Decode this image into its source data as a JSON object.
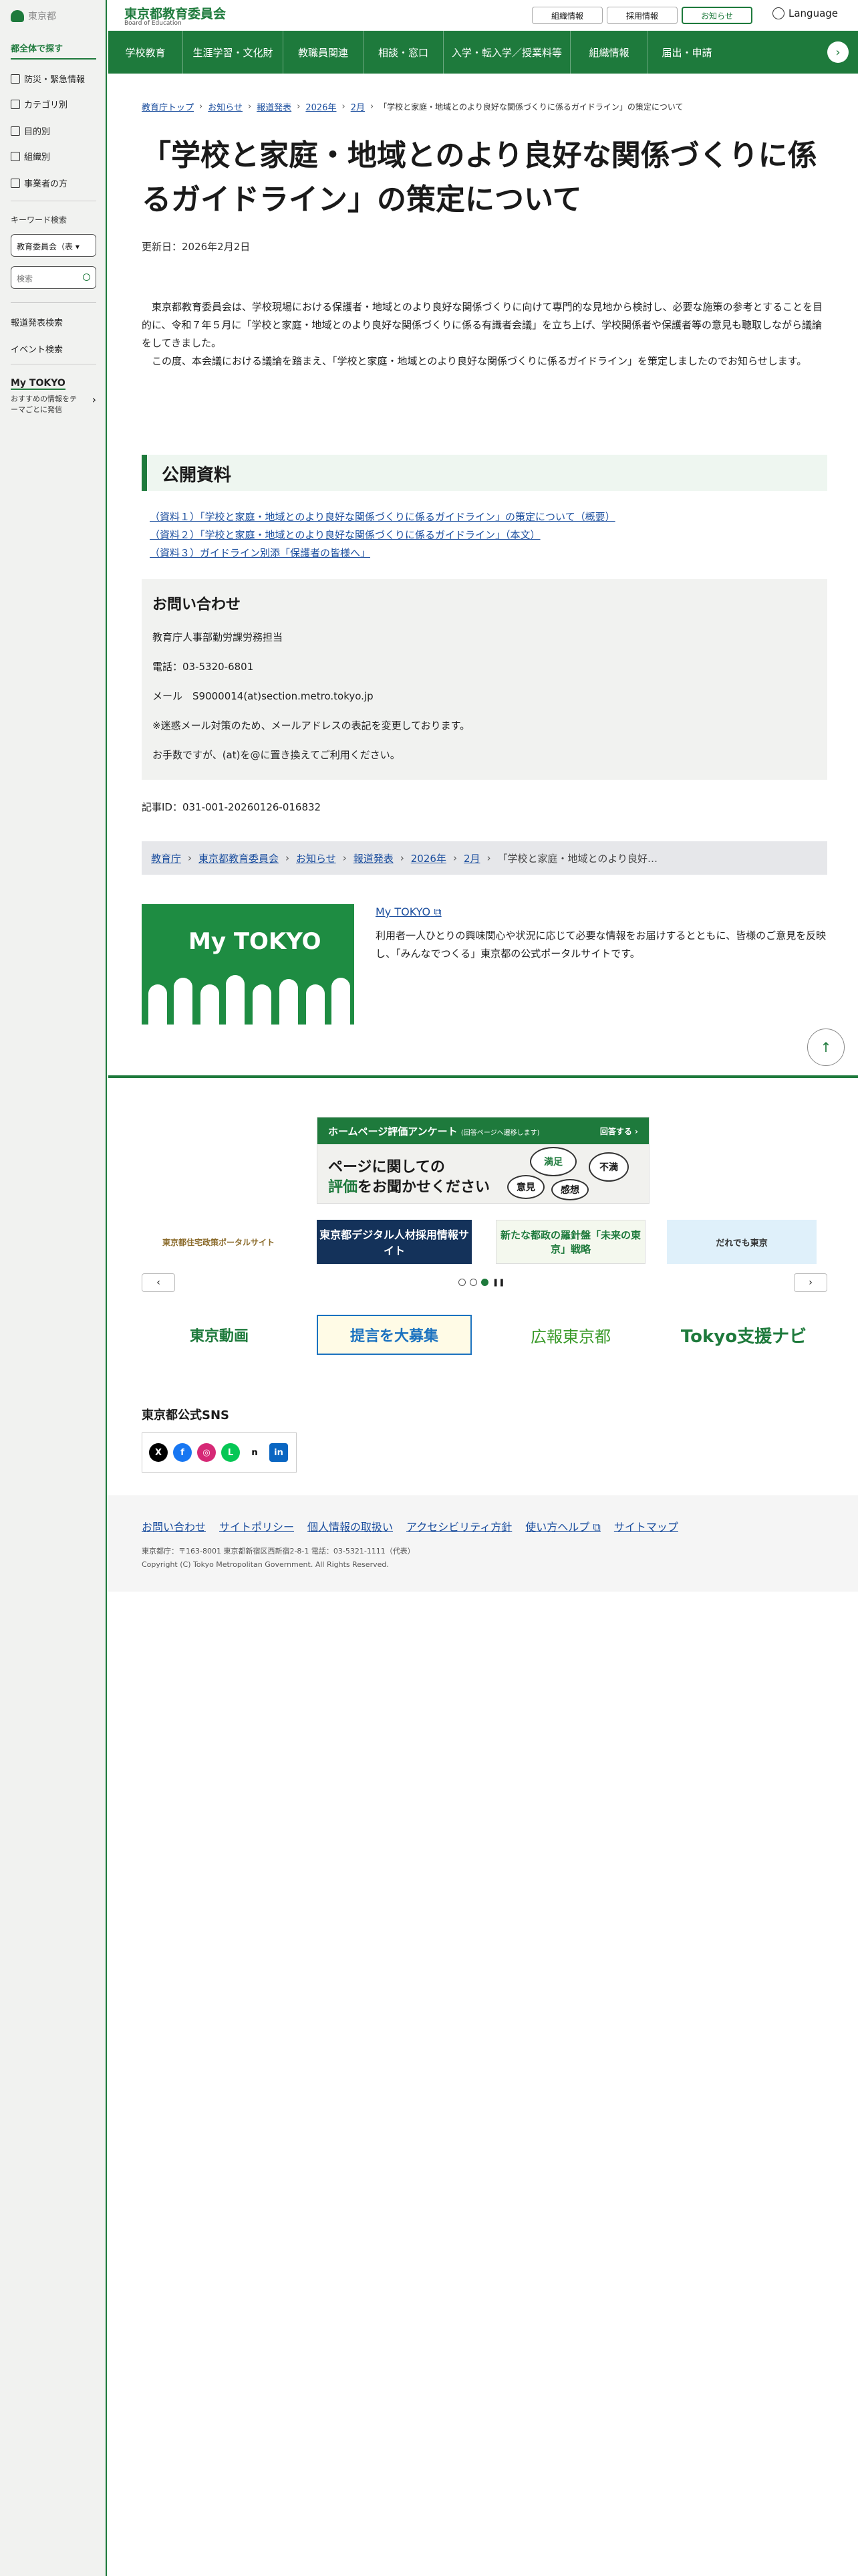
{
  "sidebar": {
    "logo": "東京都",
    "title": "都全体で探す",
    "items": [
      {
        "label": "防災・緊急情報",
        "icon": "speaker-icon"
      },
      {
        "label": "カテゴリ別",
        "icon": "tag-icon"
      },
      {
        "label": "目的別",
        "icon": "document-icon"
      },
      {
        "label": "組織別",
        "icon": "org-icon"
      },
      {
        "label": "事業者の方",
        "icon": "building-icon"
      }
    ],
    "keyword_label": "キーワード検索",
    "select_value": "教育委員会（表",
    "search_placeholder": "検索",
    "links": [
      "報道発表検索",
      "イベント検索"
    ],
    "mytokyo_title": "My TOKYO",
    "mytokyo_sub": "おすすめの情報をテーマごとに発信"
  },
  "header": {
    "title": "東京都教育委員会",
    "subtitle": "Board of Education",
    "buttons": [
      "組織情報",
      "採用情報",
      "お知らせ"
    ],
    "language": "Language"
  },
  "gnav": [
    "学校教育",
    "生涯学習・文化財",
    "教職員関連",
    "相談・窓口",
    "入学・転入学／授業料等",
    "組織情報",
    "届出・申請"
  ],
  "breadcrumb": [
    "教育庁トップ",
    "お知らせ",
    "報道発表",
    "2026年",
    "2月"
  ],
  "breadcrumb_current": "「学校と家庭・地域とのより良好な関係づくりに係るガイドライン」の策定について",
  "page": {
    "title": "「学校と家庭・地域とのより良好な関係づくりに係るガイドライン」の策定について",
    "updated": "更新日：2026年2月2日",
    "para1": "東京都教育委員会は、学校現場における保護者・地域とのより良好な関係づくりに向けて専門的な見地から検討し、必要な施策の参考とすることを目的に、令和７年５月に「学校と家庭・地域とのより良好な関係づくりに係る有識者会議」を立ち上げ、学校関係者や保護者等の意見も聴取しながら議論をしてきました。",
    "para2": "この度、本会議における議論を踏まえ、「学校と家庭・地域とのより良好な関係づくりに係るガイドライン」を策定しましたのでお知らせします。",
    "section_title": "公開資料",
    "resources": [
      "（資料１）「学校と家庭・地域とのより良好な関係づくりに係るガイドライン」の策定について（概要）",
      "（資料２）「学校と家庭・地域とのより良好な関係づくりに係るガイドライン」（本文）",
      "（資料３）ガイドライン別添「保護者の皆様へ」"
    ],
    "contact_title": "お問い合わせ",
    "contact_lines": [
      "教育庁人事部勤労課労務担当",
      "電話：03-5320-6801",
      "メール　S9000014(at)section.metro.tokyo.jp",
      "※迷惑メール対策のため、メールアドレスの表記を変更しております。",
      "お手数ですが、(at)を@に置き換えてご利用ください。"
    ],
    "article_id": "記事ID：031-001-20260126-016832"
  },
  "breadcrumb2": [
    "教育庁",
    "東京都教育委員会",
    "お知らせ",
    "報道発表",
    "2026年",
    "2月"
  ],
  "breadcrumb2_current": "「学校と家庭・地域とのより良好…",
  "mytokyo": {
    "logo": "My TOKYO",
    "link": "My TOKYO",
    "desc": "利用者一人ひとりの興味関心や状況に応じて必要な情報をお届けするとともに、皆様のご意見を反映し、「みんなでつくる」東京都の公式ポータルサイトです。"
  },
  "survey": {
    "bar": "ホームページ評価アンケート",
    "bar_small": "(回答ページへ遷移します)",
    "answer": "回答する ›",
    "q1": "ページに関しての",
    "q2a": "評価",
    "q2b": "をお聞かせください",
    "bubbles": [
      "満足",
      "不満",
      "意見",
      "感想"
    ]
  },
  "banners": [
    "東京都住宅政策ポータルサイト",
    "東京都デジタル人材採用情報サイト",
    "新たな都政の羅針盤「未来の東京」戦略",
    "だれでも東京"
  ],
  "banners2": [
    "東京動画",
    "提言を大募集",
    "広報東京都",
    "Tokyo支援ナビ"
  ],
  "sns_title": "東京都公式SNS",
  "sns": [
    "X",
    "f",
    "◎",
    "L",
    "n",
    "in"
  ],
  "footer": {
    "links": [
      "お問い合わせ",
      "サイトポリシー",
      "個人情報の取扱い",
      "アクセシビリティ方針",
      "使い方ヘルプ",
      "サイトマップ"
    ],
    "address": "東京都庁：〒163-8001 東京都新宿区西新宿2-8-1 電話：03-5321-1111（代表）",
    "copyright": "Copyright (C) Tokyo Metropolitan Government. All Rights Reserved."
  },
  "colors": {
    "brand": "#1e7a3c",
    "link": "#1b4e9e"
  }
}
